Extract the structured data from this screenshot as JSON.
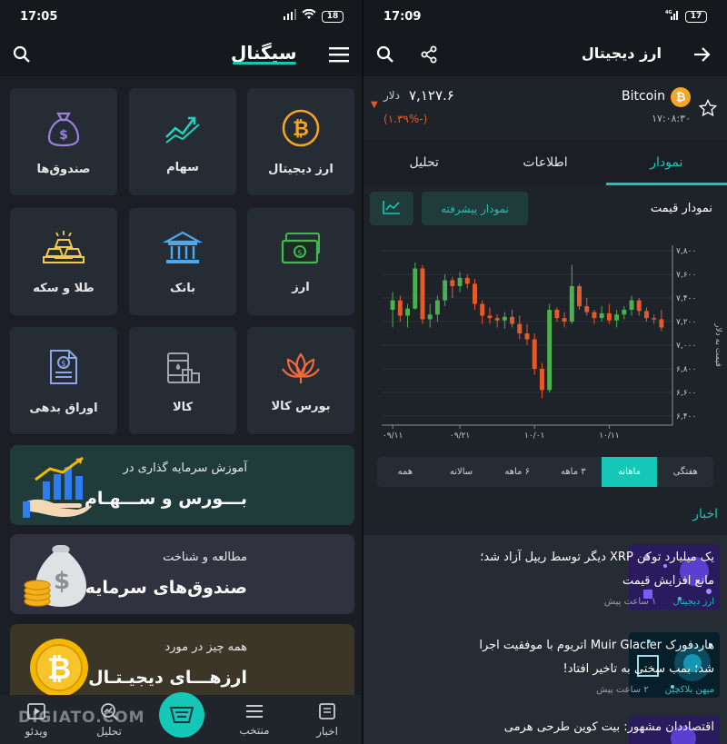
{
  "left": {
    "status": {
      "time": "17:05",
      "battery": "18"
    },
    "logo": "سیگنال",
    "tiles": [
      {
        "label": "ارز دیجیتال",
        "icon": "bitcoin-icon"
      },
      {
        "label": "سهام",
        "icon": "stock-chart-icon"
      },
      {
        "label": "صندوق‌ها",
        "icon": "money-bag-icon"
      },
      {
        "label": "ارز",
        "icon": "banknote-icon"
      },
      {
        "label": "بانک",
        "icon": "bank-icon"
      },
      {
        "label": "طلا و سکه",
        "icon": "gold-bars-icon"
      },
      {
        "label": "بورس کالا",
        "icon": "lotus-icon"
      },
      {
        "label": "کالا",
        "icon": "barrel-icon"
      },
      {
        "label": "اوراق بدهی",
        "icon": "bond-document-icon"
      }
    ],
    "banners": [
      {
        "sub": "آموزش سرمایه گذاری در",
        "big": "بـــورس و ســـهـام"
      },
      {
        "sub": "مطالعه و شناخت",
        "big": "صندوق‌های سرمایه‌گذاری"
      },
      {
        "sub": "همه چیز در مورد",
        "big": "ارزهـــای دیجیـتـال"
      }
    ],
    "nav": {
      "news": "اخبار",
      "selected": "منتخب",
      "analysis": "تحلیل",
      "video": "ویدئو"
    },
    "watermark": "DIGIATO.COM"
  },
  "right": {
    "status": {
      "time": "17:09",
      "battery": "17"
    },
    "title": "ارز دیجیتال",
    "coin": {
      "name": "Bitcoin",
      "time": "۱۷:۰۸:۳۰",
      "price": "۷,۱۲۷.۶",
      "unit": "دلار",
      "change": "(-۱.۳۹%)"
    },
    "tabs": [
      "نمودار",
      "اطلاعات",
      "تحلیل"
    ],
    "chart_title": "نمودار قیمت",
    "advanced_button": "نمودار پیشرفته",
    "periods": [
      "هفتگی",
      "ماهانه",
      "۳ ماهه",
      "۶ ماهه",
      "سالانه",
      "همه"
    ],
    "news_heading": "اخبار",
    "news": [
      {
        "title": "یک میلیارد توکن XRP دیگر توسط ریپل آزاد شد؛ مانع افزایش قیمت",
        "time": "۱ ساعت پیش",
        "category": "ارز دیجیتال"
      },
      {
        "title": "هاردفورک Muir Glacier اتریوم با موفقیت اجرا شد؛ بمب سختی به تاخیر افتاد!",
        "time": "۲ ساعت پیش",
        "category": "میهن بلاکچین"
      },
      {
        "title": "اقتصاددان مشهور: بیت کوین طرحی هرمی",
        "time": "",
        "category": ""
      }
    ]
  },
  "chart_data": {
    "type": "candlestick",
    "ylabel": "قیمت به دلار",
    "ylim": [
      6400,
      7800
    ],
    "yticks": [
      "۷,۸۰۰",
      "۷,۶۰۰",
      "۷,۴۰۰",
      "۷,۲۰۰",
      "۷,۰۰۰",
      "۶,۸۰۰",
      "۶,۶۰۰",
      "۶,۴۰۰"
    ],
    "ytick_values": [
      7800,
      7600,
      7400,
      7200,
      7000,
      6800,
      6600,
      6400
    ],
    "xticks": [
      "۰۹/۱۱",
      "۰۹/۲۱",
      "۱۰/۰۱",
      "۱۰/۱۱"
    ],
    "colors": {
      "up": "#4caf50",
      "down": "#e8592a"
    },
    "candles": [
      {
        "o": 7300,
        "h": 7450,
        "l": 7150,
        "c": 7380
      },
      {
        "o": 7380,
        "h": 7420,
        "l": 7200,
        "c": 7250
      },
      {
        "o": 7250,
        "h": 7350,
        "l": 7150,
        "c": 7310
      },
      {
        "o": 7310,
        "h": 7700,
        "l": 7300,
        "c": 7650
      },
      {
        "o": 7650,
        "h": 7680,
        "l": 7180,
        "c": 7220
      },
      {
        "o": 7220,
        "h": 7350,
        "l": 7150,
        "c": 7260
      },
      {
        "o": 7260,
        "h": 7420,
        "l": 7200,
        "c": 7380
      },
      {
        "o": 7380,
        "h": 7600,
        "l": 7330,
        "c": 7550
      },
      {
        "o": 7550,
        "h": 7580,
        "l": 7400,
        "c": 7500
      },
      {
        "o": 7500,
        "h": 7620,
        "l": 7450,
        "c": 7570
      },
      {
        "o": 7570,
        "h": 7600,
        "l": 7480,
        "c": 7520
      },
      {
        "o": 7520,
        "h": 7560,
        "l": 7300,
        "c": 7350
      },
      {
        "o": 7350,
        "h": 7380,
        "l": 7180,
        "c": 7250
      },
      {
        "o": 7250,
        "h": 7320,
        "l": 7180,
        "c": 7230
      },
      {
        "o": 7230,
        "h": 7260,
        "l": 7150,
        "c": 7210
      },
      {
        "o": 7210,
        "h": 7280,
        "l": 7140,
        "c": 7240
      },
      {
        "o": 7240,
        "h": 7300,
        "l": 7150,
        "c": 7180
      },
      {
        "o": 7180,
        "h": 7250,
        "l": 7050,
        "c": 7100
      },
      {
        "o": 7100,
        "h": 7180,
        "l": 7000,
        "c": 7050
      },
      {
        "o": 7050,
        "h": 7100,
        "l": 6750,
        "c": 6800
      },
      {
        "o": 6800,
        "h": 6850,
        "l": 6550,
        "c": 6620
      },
      {
        "o": 6620,
        "h": 7350,
        "l": 6600,
        "c": 7300
      },
      {
        "o": 7300,
        "h": 7320,
        "l": 7200,
        "c": 7230
      },
      {
        "o": 7230,
        "h": 7280,
        "l": 7150,
        "c": 7200
      },
      {
        "o": 7200,
        "h": 7680,
        "l": 7180,
        "c": 7500
      },
      {
        "o": 7500,
        "h": 7520,
        "l": 7300,
        "c": 7330
      },
      {
        "o": 7330,
        "h": 7400,
        "l": 7250,
        "c": 7280
      },
      {
        "o": 7280,
        "h": 7300,
        "l": 7180,
        "c": 7230
      },
      {
        "o": 7230,
        "h": 7330,
        "l": 7200,
        "c": 7270
      },
      {
        "o": 7270,
        "h": 7350,
        "l": 7180,
        "c": 7210
      },
      {
        "o": 7210,
        "h": 7300,
        "l": 7150,
        "c": 7260
      },
      {
        "o": 7260,
        "h": 7330,
        "l": 7220,
        "c": 7300
      },
      {
        "o": 7300,
        "h": 7420,
        "l": 7250,
        "c": 7380
      },
      {
        "o": 7380,
        "h": 7400,
        "l": 7250,
        "c": 7290
      },
      {
        "o": 7290,
        "h": 7320,
        "l": 7200,
        "c": 7230
      },
      {
        "o": 7230,
        "h": 7260,
        "l": 7180,
        "c": 7220
      },
      {
        "o": 7220,
        "h": 7300,
        "l": 7120,
        "c": 7150
      }
    ]
  }
}
